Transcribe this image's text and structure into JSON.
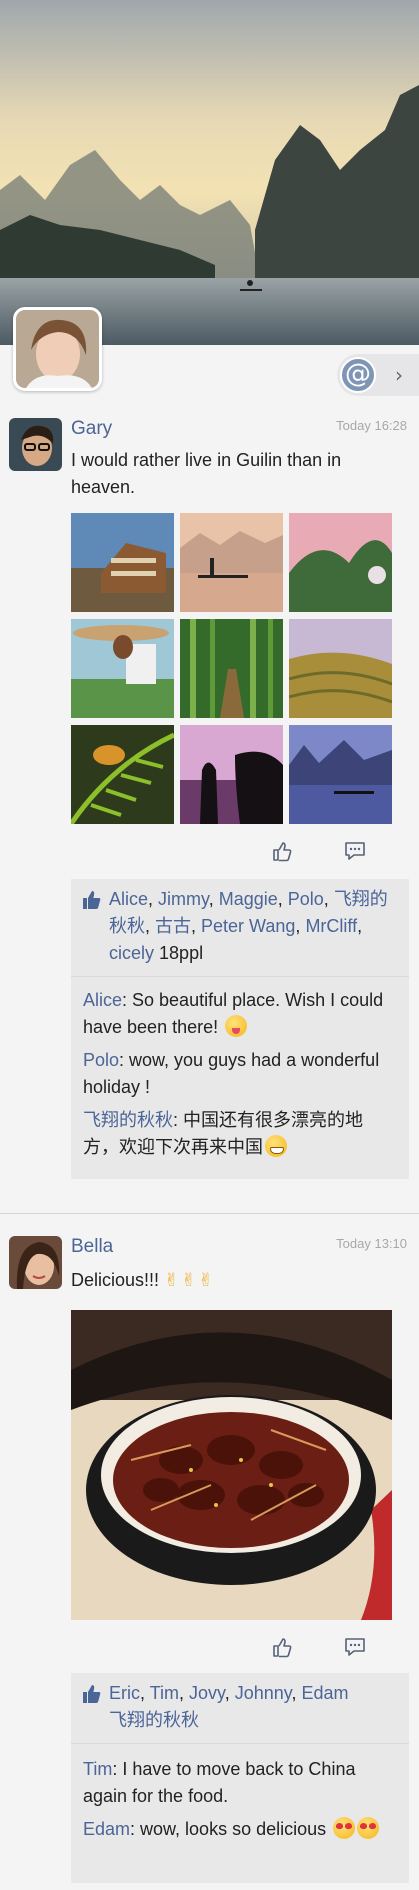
{
  "profile": {
    "cover_alt": "cover-landscape",
    "at_button_icon": "at-icon",
    "more_icon": "chevron-right-icon"
  },
  "posts": [
    {
      "author": "Gary",
      "time": "Today 16:28",
      "text": "I would rather live in Guilin than in heaven.",
      "photos": [
        "village",
        "fisherman",
        "hills",
        "farmer",
        "bamboo",
        "terraces",
        "butterfly",
        "silhouette",
        "river-dusk"
      ],
      "likes": {
        "names": [
          "Alice",
          "Jimmy",
          "Maggie",
          "Polo",
          "飞翔的秋秋",
          "古古",
          "Peter Wang",
          "MrCliff",
          "cicely"
        ],
        "count": "18ppl"
      },
      "comments": [
        {
          "who": "Alice",
          "text": ": So beautiful place. Wish I could have been there!",
          "emoji": "tongue"
        },
        {
          "who": "Polo",
          "text": ": wow, you guys had a wonderful holiday !",
          "emoji": ""
        },
        {
          "who": "飞翔的秋秋",
          "text": ": 中国还有很多漂亮的地方，欢迎下次再来中国",
          "emoji": "grin"
        }
      ]
    },
    {
      "author": "Bella",
      "time": "Today 13:10",
      "text": "Delicious!!!",
      "text_emoji": "✌✌✌",
      "likes": {
        "names": [
          "Eric",
          "Tim",
          "Jovy",
          "Johnny",
          "Edam",
          "飞翔的秋秋"
        ]
      },
      "comments": [
        {
          "who": "Tim",
          "text": ": I have to move back to China again for the food.",
          "emoji": ""
        },
        {
          "who": "Edam",
          "text": ": wow, looks so delicious",
          "emoji": "heart"
        }
      ]
    }
  ]
}
